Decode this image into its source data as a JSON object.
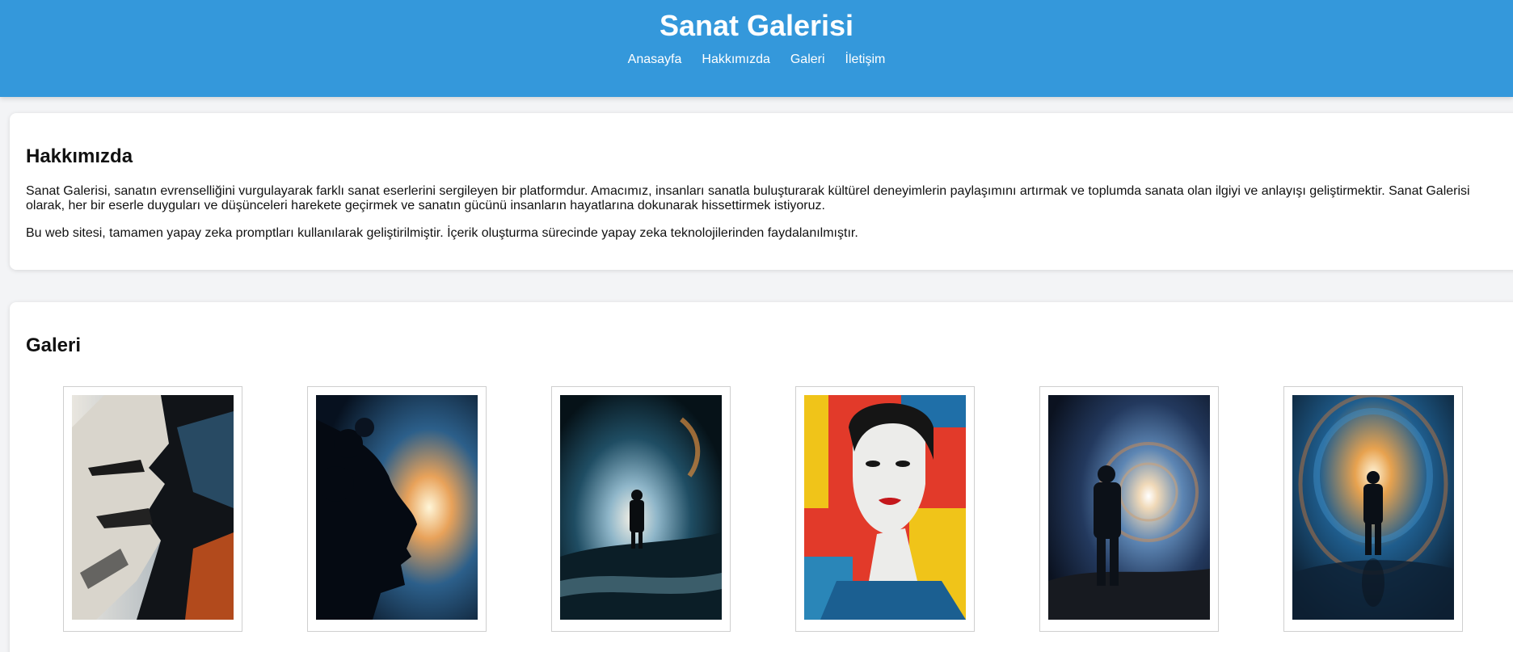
{
  "header": {
    "title": "Sanat Galerisi",
    "nav": [
      "Anasayfa",
      "Hakkımızda",
      "Galeri",
      "İletişim"
    ]
  },
  "about": {
    "heading": "Hakkımızda",
    "paragraphs": [
      "Sanat Galerisi, sanatın evrenselliğini vurgulayarak farklı sanat eserlerini sergileyen bir platformdur. Amacımız, insanları sanatla buluşturarak kültürel deneyimlerin paylaşımını artırmak ve toplumda sanata olan ilgiyi ve anlayışı geliştirmektir. Sanat Galerisi olarak, her bir eserle duyguları ve düşünceleri harekete geçirmek ve sanatın gücünü insanların hayatlarına dokunarak hissettirmek istiyoruz.",
      "Bu web sitesi, tamamen yapay zeka promptları kullanılarak geliştirilmiştir. İçerik oluşturma sürecinde yapay zeka teknolojilerinden faydalanılmıştır."
    ]
  },
  "gallery": {
    "heading": "Galeri",
    "items": [
      {
        "subject": "abstract-face-painting"
      },
      {
        "subject": "cosmic-silhouette-profile"
      },
      {
        "subject": "figure-in-cosmic-wave"
      },
      {
        "subject": "pop-art-woman-portrait"
      },
      {
        "subject": "figure-before-galaxy-spiral"
      },
      {
        "subject": "figure-walking-in-vortex"
      }
    ]
  },
  "colors": {
    "header_bg": "#3498db",
    "page_bg": "#f3f4f6",
    "card_bg": "#ffffff"
  }
}
